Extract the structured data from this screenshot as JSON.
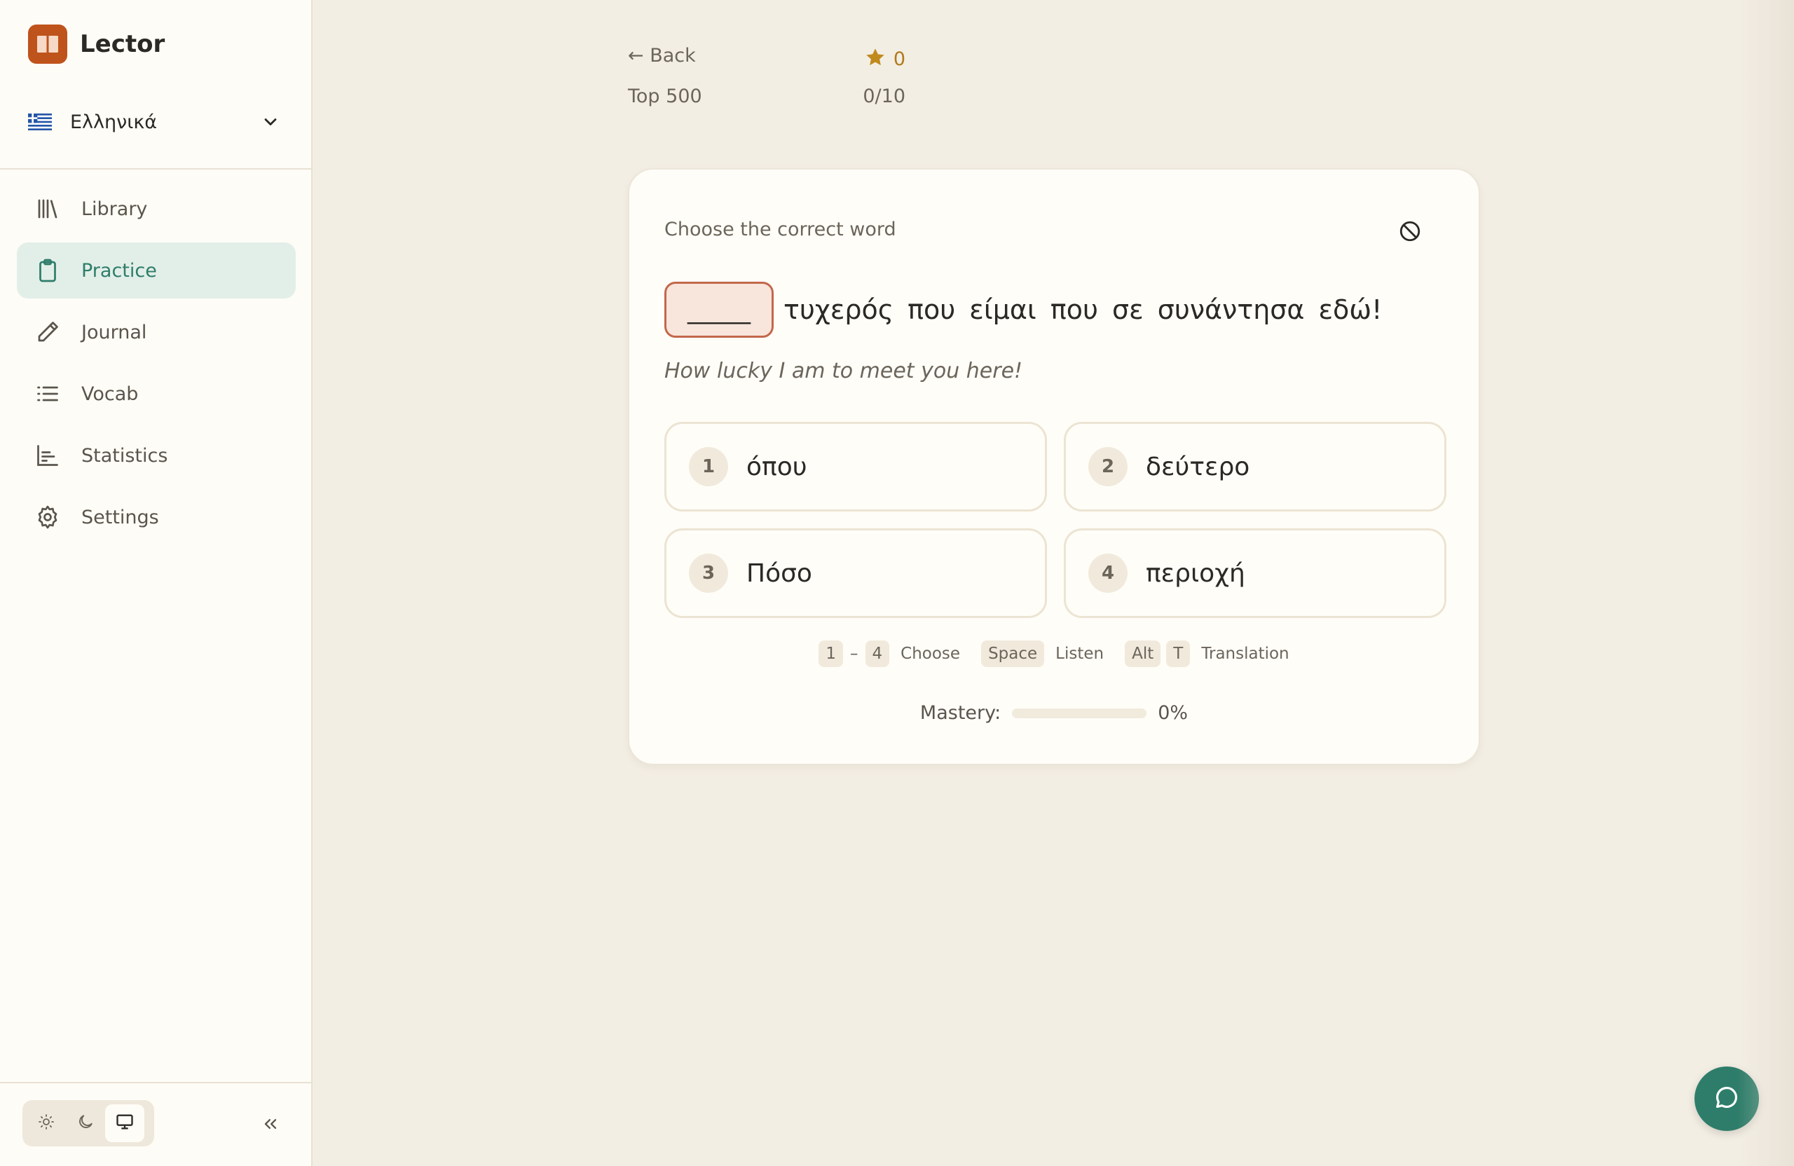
{
  "app": {
    "name": "Lector"
  },
  "language": {
    "name": "Ελληνικά",
    "flag": "greece-flag"
  },
  "sidebar": {
    "items": [
      {
        "label": "Library",
        "icon": "library-icon",
        "active": false
      },
      {
        "label": "Practice",
        "icon": "clipboard-icon",
        "active": true
      },
      {
        "label": "Journal",
        "icon": "pencil-icon",
        "active": false
      },
      {
        "label": "Vocab",
        "icon": "list-icon",
        "active": false
      },
      {
        "label": "Statistics",
        "icon": "bar-chart-icon",
        "active": false
      },
      {
        "label": "Settings",
        "icon": "gear-icon",
        "active": false
      }
    ],
    "theme_active": "system"
  },
  "header": {
    "back_label": "← Back",
    "deck_name": "Top 500",
    "streak_count": "0",
    "progress": "0/10"
  },
  "exercise": {
    "prompt": "Choose the correct word",
    "blank": "_____",
    "sentence_rest": "τυχερός που είμαι που σε συνάντησα εδώ!",
    "translation": "How lucky I am to meet you here!",
    "options": [
      {
        "num": "1",
        "word": "όπου"
      },
      {
        "num": "2",
        "word": "δεύτερο"
      },
      {
        "num": "3",
        "word": "Πόσο"
      },
      {
        "num": "4",
        "word": "περιοχή"
      }
    ],
    "hints": {
      "range_start": "1",
      "range_sep": "–",
      "range_end": "4",
      "choose_label": "Choose",
      "space_key": "Space",
      "listen_label": "Listen",
      "alt_key": "Alt",
      "t_key": "T",
      "translation_label": "Translation"
    },
    "mastery": {
      "label": "Mastery:",
      "value": "0%",
      "fraction": 0
    }
  },
  "colors": {
    "accent": "#2e7d6a",
    "brand": "#bf531c",
    "star": "#c08a1e"
  }
}
